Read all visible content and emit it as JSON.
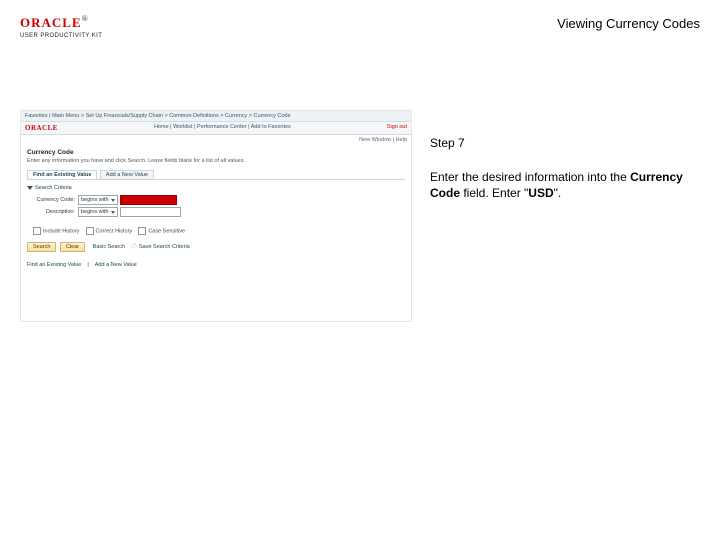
{
  "header": {
    "logo_text": "ORACLE",
    "logo_sub": "USER PRODUCTIVITY KIT",
    "page_title": "Viewing Currency Codes"
  },
  "instruction": {
    "step_label": "Step 7",
    "body_pre": "Enter the desired information into the ",
    "body_bold1": "Currency Code",
    "body_mid": " field. Enter \"",
    "body_bold2": "USD",
    "body_post": "\"."
  },
  "shot": {
    "nav": {
      "crumbs": "Favorites   |   Main Menu   >   Set Up Financials/Supply Chain   >   Common Definitions   >   Currency   >   Currency Code",
      "mini_logo": "ORACLE",
      "subnav_left": "Home   |   Worklist   |   Performance Center   |   Add to Favorites",
      "subnav_right": "Sign out",
      "auxline": "New Window | Help"
    },
    "section_title": "Currency Code",
    "hint_text": "Enter any information you have and click Search. Leave fields blank for a list of all values.",
    "tabs": {
      "t1": "Find an Existing Value",
      "t2": "Add a New Value"
    },
    "criteria": {
      "head": "Search Criteria",
      "row1_label": "Currency Code:",
      "row1_op": "begins with",
      "row2_label": "Description:",
      "row2_op": "begins with"
    },
    "checks": {
      "c1": "Include History",
      "c2": "Correct History",
      "c3": "Case Sensitive"
    },
    "buttons": {
      "b1": "Search",
      "b2": "Clear",
      "basic": "Basic Search",
      "save": "Save Search Criteria"
    },
    "footer": {
      "f1": "Find an Existing Value",
      "f2": "Add a New Value"
    }
  }
}
